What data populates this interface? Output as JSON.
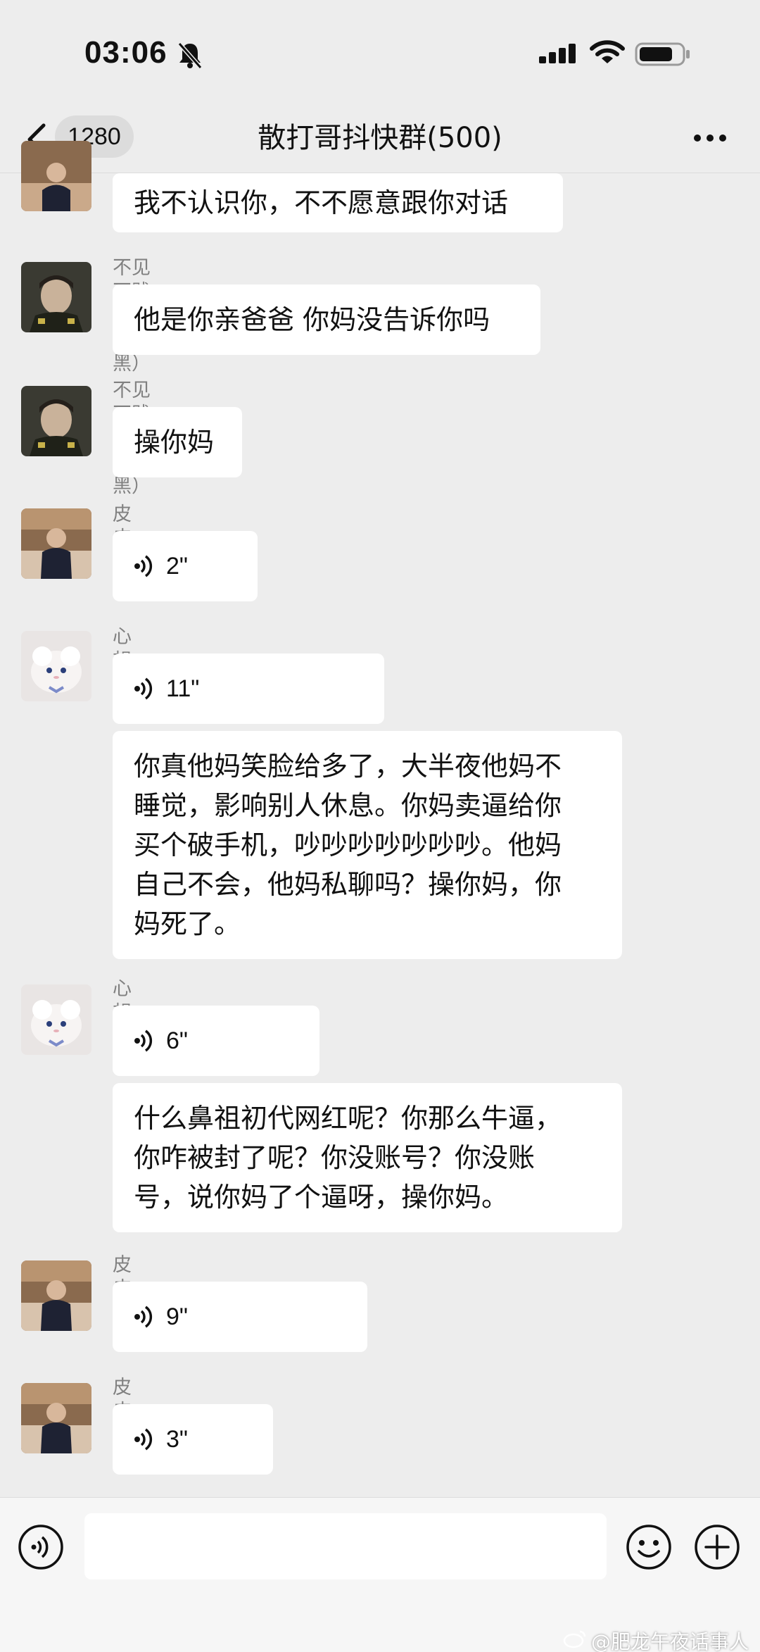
{
  "status_bar": {
    "time": "03:06"
  },
  "nav": {
    "unread_count": "1280",
    "title": "散打哥抖快群(500)"
  },
  "messages": [
    {
      "text": "我不认识你，不不愿意跟你对话"
    },
    {
      "sender": "不见不贱（借钱拉黑）",
      "text": "他是你亲爸爸 你妈没告诉你吗"
    },
    {
      "sender": "不见不贱（借钱拉黑）",
      "text": "操你妈"
    },
    {
      "sender": "皮皮。",
      "voice": "2\""
    },
    {
      "sender": "心想乐宝",
      "voice": "11\"",
      "text_lines": [
        "你真他妈笑脸给多了，大半夜他妈不",
        "睡觉，影响别人休息。你妈卖逼给你",
        "买个破手机，吵吵吵吵吵吵吵。他妈",
        "自己不会，他妈私聊吗？操你妈，你",
        "妈死了。"
      ]
    },
    {
      "sender": "心想乐宝",
      "voice": "6\"",
      "text_lines": [
        "什么鼻祖初代网红呢？你那么牛逼，",
        "你咋被封了呢？你没账号？你没账",
        "号，说你妈了个逼呀，操你妈。"
      ]
    },
    {
      "sender": "皮皮。",
      "voice": "9\""
    },
    {
      "sender": "皮皮。",
      "voice": "3\""
    }
  ],
  "watermark": "@肥龙午夜话事人",
  "colors": {
    "background": "#ededed",
    "bubble": "#ffffff",
    "name": "#808080"
  }
}
